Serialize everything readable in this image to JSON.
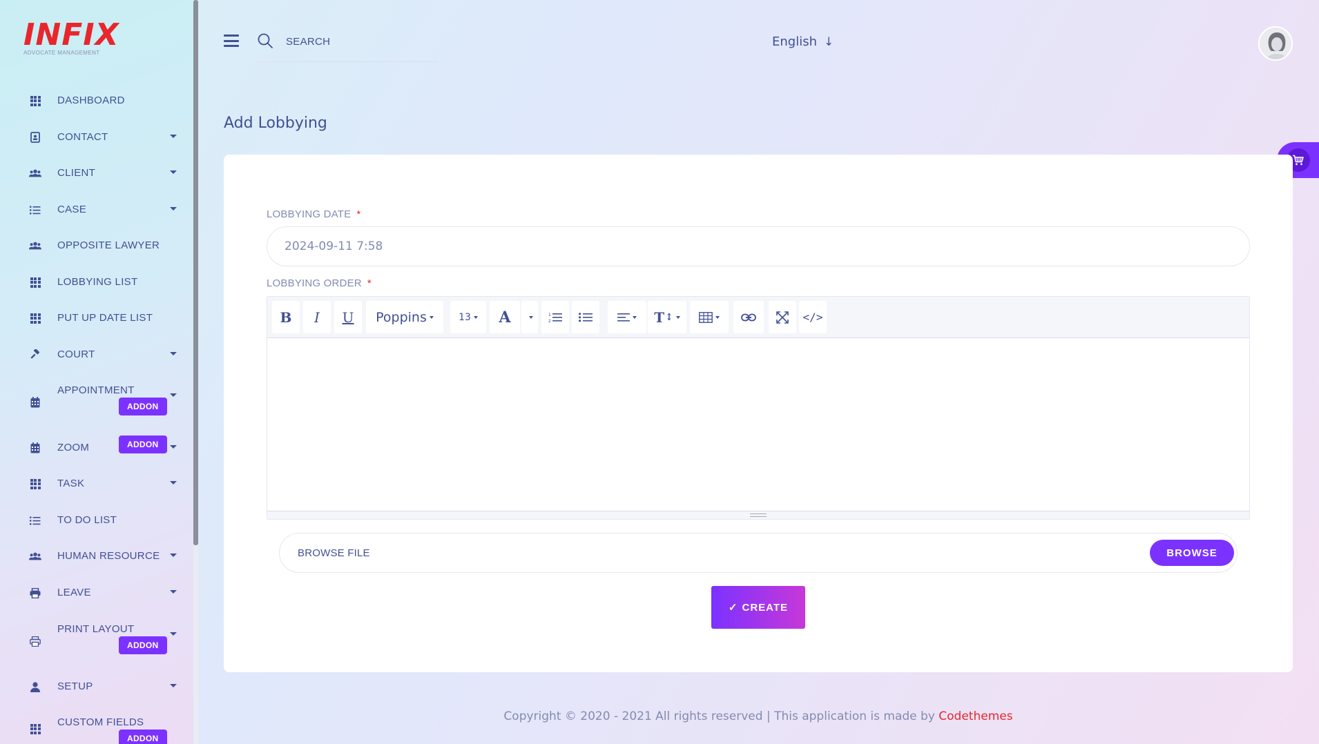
{
  "brand": {
    "logo_text": "INFIX",
    "logo_sub": "ADVOCATE MANAGEMENT"
  },
  "sidebar": {
    "items": [
      {
        "label": "DASHBOARD",
        "icon": "grid-icon",
        "caret": false
      },
      {
        "label": "CONTACT",
        "icon": "contact-book-icon",
        "caret": true
      },
      {
        "label": "CLIENT",
        "icon": "users-icon",
        "caret": true
      },
      {
        "label": "CASE",
        "icon": "list-icon",
        "caret": true
      },
      {
        "label": "OPPOSITE LAWYER",
        "icon": "users-icon",
        "caret": false
      },
      {
        "label": "LOBBYING LIST",
        "icon": "grid-icon",
        "caret": false
      },
      {
        "label": "PUT UP DATE LIST",
        "icon": "grid-icon",
        "caret": false
      },
      {
        "label": "COURT",
        "icon": "gavel-icon",
        "caret": true
      },
      {
        "label": "APPOINTMENT",
        "icon": "calendar-icon",
        "caret": true,
        "addon": "ADDON"
      },
      {
        "label": "ZOOM",
        "icon": "calendar-icon",
        "caret": true,
        "addon": "ADDON"
      },
      {
        "label": "TASK",
        "icon": "grid-icon",
        "caret": true
      },
      {
        "label": "TO DO LIST",
        "icon": "list-icon",
        "caret": false
      },
      {
        "label": "HUMAN RESOURCE",
        "icon": "users-icon",
        "caret": true
      },
      {
        "label": "LEAVE",
        "icon": "printer-icon",
        "caret": true
      },
      {
        "label": "PRINT LAYOUT",
        "icon": "printer-icon",
        "caret": true,
        "addon": "ADDON"
      },
      {
        "label": "SETUP",
        "icon": "user-icon",
        "caret": true
      },
      {
        "label": "CUSTOM FIELDS",
        "icon": "grid-icon",
        "caret": false,
        "addon": "ADDON"
      }
    ]
  },
  "header": {
    "search_placeholder": "SEARCH",
    "language": "English",
    "language_arrow": "↓"
  },
  "main": {
    "title": "Add Lobbying",
    "form": {
      "date_label": "LOBBYING DATE",
      "date_value": "2024-09-11 7:58",
      "order_label": "LOBBYING ORDER",
      "required_mark": "*",
      "toolbar": {
        "bold": "B",
        "italic": "I",
        "underline": "U",
        "font_family": "Poppins",
        "font_size": "13",
        "color": "A",
        "text_size": "T",
        "code_view": "</>"
      },
      "file_label": "BROWSE FILE",
      "browse_label": "BROWSE",
      "create_label": "CREATE",
      "create_check": "✓"
    }
  },
  "footer": {
    "text": "Copyright © 2020 - 2021 All rights reserved | This application is made by ",
    "brand": "Codethemes"
  },
  "colors": {
    "accent": "#7c32ff",
    "text": "#415094",
    "muted": "#828bb2",
    "required": "#e8262c"
  }
}
